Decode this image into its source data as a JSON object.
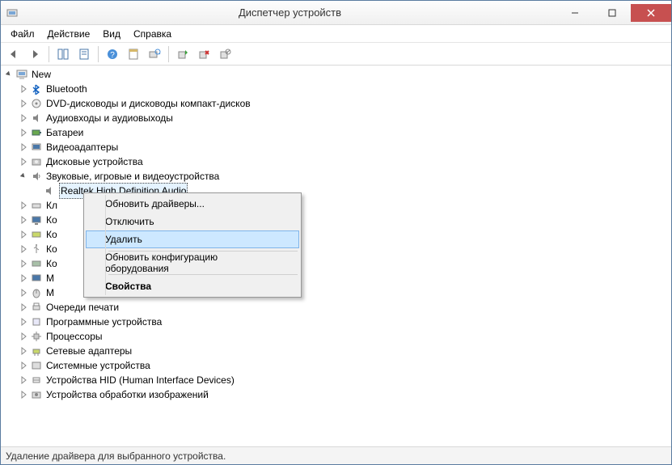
{
  "window": {
    "title": "Диспетчер устройств"
  },
  "menus": {
    "file": "Файл",
    "action": "Действие",
    "view": "Вид",
    "help": "Справка"
  },
  "tree": {
    "root": "New",
    "items": [
      "Bluetooth",
      "DVD-дисководы и дисководы компакт-дисков",
      "Аудиовходы и аудиовыходы",
      "Батареи",
      "Видеоадаптеры",
      "Дисковые устройства",
      "Звуковые, игровые и видеоустройства",
      "Кл",
      "Ко",
      "Ко",
      "Ко",
      "Ко",
      "М",
      "М",
      "Очереди печати",
      "Программные устройства",
      "Процессоры",
      "Сетевые адаптеры",
      "Системные устройства",
      "Устройства HID (Human Interface Devices)",
      "Устройства обработки изображений"
    ],
    "selected_child": "Realtek High Definition Audio"
  },
  "context_menu": {
    "update_drivers": "Обновить драйверы...",
    "disable": "Отключить",
    "uninstall": "Удалить",
    "scan_hw": "Обновить конфигурацию оборудования",
    "properties": "Свойства"
  },
  "status": {
    "text": "Удаление драйвера для выбранного устройства."
  }
}
